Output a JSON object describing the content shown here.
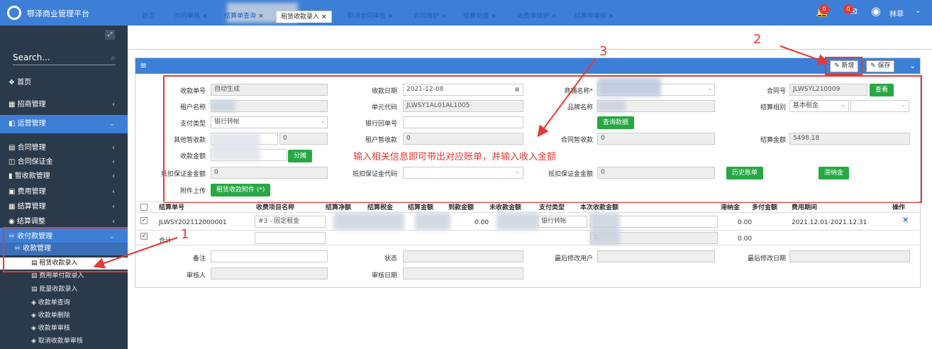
{
  "app": {
    "title": "鄂泽商业管理平台",
    "user": "林菲",
    "badge1": "0",
    "badge2": "0"
  },
  "sidebar": {
    "search": "Search...",
    "items": [
      {
        "label": "首页"
      },
      {
        "label": "招商管理"
      },
      {
        "label": "运营管理"
      },
      {
        "label": "合同管理"
      },
      {
        "label": "合同保证金"
      },
      {
        "label": "暂收款管理"
      },
      {
        "label": "费用管理"
      },
      {
        "label": "结算管理"
      },
      {
        "label": "结算调整"
      },
      {
        "label": "收付款管理"
      },
      {
        "label": "收款管理"
      }
    ],
    "subs": [
      {
        "label": "租赁收款录入"
      },
      {
        "label": "费用单付款录入"
      },
      {
        "label": "批量收款录入"
      },
      {
        "label": "收款单查询"
      },
      {
        "label": "收款单删除"
      },
      {
        "label": "收款单审核"
      },
      {
        "label": "取消收款单审核"
      }
    ]
  },
  "tabs": [
    "首页",
    "合同审核",
    "结算单查询",
    "租赁收款录入",
    "取消合同审核",
    "合同维护",
    "结算处理",
    "收费单维护",
    "结算单审核"
  ],
  "toolbar": {
    "new": "新增",
    "save": "保存"
  },
  "form": {
    "receipt_no_label": "收款单号",
    "receipt_no": "自动生成",
    "receipt_date_label": "收款日期",
    "receipt_date": "2021-12-08",
    "shop_label": "商铺名称*",
    "contract_no_label": "合同号",
    "contract_no": "JLWSYL210009",
    "view": "查看",
    "tenant_label": "租户名称",
    "unit_label": "单元代码",
    "unit": "JLWSY1AL01AL1005",
    "brand_label": "品牌名称",
    "settle_group_label": "结算组别",
    "settle_group": "基本租金",
    "pay_type_label": "支付类型",
    "pay_type": "银行转帐",
    "bank_no_label": "银行回单号",
    "query": "查询数据",
    "other_tmp_label": "其他暂收款",
    "other_tmp": "0",
    "tenant_tmp_label": "租户暂收款",
    "tenant_tmp": "0",
    "contract_tmp_label": "合同暂收款",
    "contract_tmp": "0",
    "settle_amt_label": "结算金额",
    "settle_amt": "5498.18",
    "amount_label": "收款金额",
    "split": "分摊",
    "deposit_amt_label": "抵扣保证金金额",
    "deposit_amt": "0",
    "deposit_code_label": "抵扣保证金代码",
    "deposit_amt2_label": "抵扣保证金金额",
    "deposit_amt2": "0",
    "history": "历史账单",
    "late": "滞纳金",
    "attach_label": "附件上传",
    "attach": "租赁收款附件 (*)"
  },
  "annot": {
    "text": "输入相关信息即可带出对应账单，并输入收入金额",
    "n1": "1",
    "n2": "2",
    "n3": "3"
  },
  "table": {
    "headers": [
      "结算单号",
      "收费项目名称",
      "结算净额",
      "结算税金",
      "结算金额",
      "到款金额",
      "未收款金额",
      "支付类型",
      "本次收款金额",
      "滞纳金",
      "多付金额",
      "费用期间",
      "操作"
    ],
    "row": {
      "no": "JLWSY202112000001",
      "item": "#3 - 固定租金",
      "arrived": "0.00",
      "paytype": "银行转帐",
      "late": "0.00",
      "period": "2021.12.01-2021.12.31"
    },
    "total": {
      "label": "合计",
      "amt": "5.",
      "late": "0.00"
    }
  },
  "footer": {
    "remark": "备注",
    "status": "状态",
    "last_user": "最后修改用户",
    "last_date": "最后修改日期",
    "auditor": "审核人",
    "audit_date": "审核日期"
  }
}
